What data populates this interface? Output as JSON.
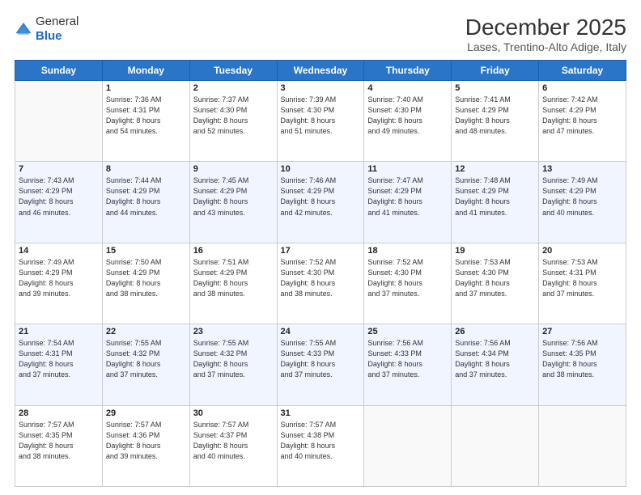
{
  "logo": {
    "general": "General",
    "blue": "Blue"
  },
  "header": {
    "title": "December 2025",
    "subtitle": "Lases, Trentino-Alto Adige, Italy"
  },
  "days_of_week": [
    "Sunday",
    "Monday",
    "Tuesday",
    "Wednesday",
    "Thursday",
    "Friday",
    "Saturday"
  ],
  "weeks": [
    [
      {
        "day": "",
        "info": ""
      },
      {
        "day": "1",
        "info": "Sunrise: 7:36 AM\nSunset: 4:31 PM\nDaylight: 8 hours\nand 54 minutes."
      },
      {
        "day": "2",
        "info": "Sunrise: 7:37 AM\nSunset: 4:30 PM\nDaylight: 8 hours\nand 52 minutes."
      },
      {
        "day": "3",
        "info": "Sunrise: 7:39 AM\nSunset: 4:30 PM\nDaylight: 8 hours\nand 51 minutes."
      },
      {
        "day": "4",
        "info": "Sunrise: 7:40 AM\nSunset: 4:30 PM\nDaylight: 8 hours\nand 49 minutes."
      },
      {
        "day": "5",
        "info": "Sunrise: 7:41 AM\nSunset: 4:29 PM\nDaylight: 8 hours\nand 48 minutes."
      },
      {
        "day": "6",
        "info": "Sunrise: 7:42 AM\nSunset: 4:29 PM\nDaylight: 8 hours\nand 47 minutes."
      }
    ],
    [
      {
        "day": "7",
        "info": "Sunrise: 7:43 AM\nSunset: 4:29 PM\nDaylight: 8 hours\nand 46 minutes."
      },
      {
        "day": "8",
        "info": "Sunrise: 7:44 AM\nSunset: 4:29 PM\nDaylight: 8 hours\nand 44 minutes."
      },
      {
        "day": "9",
        "info": "Sunrise: 7:45 AM\nSunset: 4:29 PM\nDaylight: 8 hours\nand 43 minutes."
      },
      {
        "day": "10",
        "info": "Sunrise: 7:46 AM\nSunset: 4:29 PM\nDaylight: 8 hours\nand 42 minutes."
      },
      {
        "day": "11",
        "info": "Sunrise: 7:47 AM\nSunset: 4:29 PM\nDaylight: 8 hours\nand 41 minutes."
      },
      {
        "day": "12",
        "info": "Sunrise: 7:48 AM\nSunset: 4:29 PM\nDaylight: 8 hours\nand 41 minutes."
      },
      {
        "day": "13",
        "info": "Sunrise: 7:49 AM\nSunset: 4:29 PM\nDaylight: 8 hours\nand 40 minutes."
      }
    ],
    [
      {
        "day": "14",
        "info": "Sunrise: 7:49 AM\nSunset: 4:29 PM\nDaylight: 8 hours\nand 39 minutes."
      },
      {
        "day": "15",
        "info": "Sunrise: 7:50 AM\nSunset: 4:29 PM\nDaylight: 8 hours\nand 38 minutes."
      },
      {
        "day": "16",
        "info": "Sunrise: 7:51 AM\nSunset: 4:29 PM\nDaylight: 8 hours\nand 38 minutes."
      },
      {
        "day": "17",
        "info": "Sunrise: 7:52 AM\nSunset: 4:30 PM\nDaylight: 8 hours\nand 38 minutes."
      },
      {
        "day": "18",
        "info": "Sunrise: 7:52 AM\nSunset: 4:30 PM\nDaylight: 8 hours\nand 37 minutes."
      },
      {
        "day": "19",
        "info": "Sunrise: 7:53 AM\nSunset: 4:30 PM\nDaylight: 8 hours\nand 37 minutes."
      },
      {
        "day": "20",
        "info": "Sunrise: 7:53 AM\nSunset: 4:31 PM\nDaylight: 8 hours\nand 37 minutes."
      }
    ],
    [
      {
        "day": "21",
        "info": "Sunrise: 7:54 AM\nSunset: 4:31 PM\nDaylight: 8 hours\nand 37 minutes."
      },
      {
        "day": "22",
        "info": "Sunrise: 7:55 AM\nSunset: 4:32 PM\nDaylight: 8 hours\nand 37 minutes."
      },
      {
        "day": "23",
        "info": "Sunrise: 7:55 AM\nSunset: 4:32 PM\nDaylight: 8 hours\nand 37 minutes."
      },
      {
        "day": "24",
        "info": "Sunrise: 7:55 AM\nSunset: 4:33 PM\nDaylight: 8 hours\nand 37 minutes."
      },
      {
        "day": "25",
        "info": "Sunrise: 7:56 AM\nSunset: 4:33 PM\nDaylight: 8 hours\nand 37 minutes."
      },
      {
        "day": "26",
        "info": "Sunrise: 7:56 AM\nSunset: 4:34 PM\nDaylight: 8 hours\nand 37 minutes."
      },
      {
        "day": "27",
        "info": "Sunrise: 7:56 AM\nSunset: 4:35 PM\nDaylight: 8 hours\nand 38 minutes."
      }
    ],
    [
      {
        "day": "28",
        "info": "Sunrise: 7:57 AM\nSunset: 4:35 PM\nDaylight: 8 hours\nand 38 minutes."
      },
      {
        "day": "29",
        "info": "Sunrise: 7:57 AM\nSunset: 4:36 PM\nDaylight: 8 hours\nand 39 minutes."
      },
      {
        "day": "30",
        "info": "Sunrise: 7:57 AM\nSunset: 4:37 PM\nDaylight: 8 hours\nand 40 minutes."
      },
      {
        "day": "31",
        "info": "Sunrise: 7:57 AM\nSunset: 4:38 PM\nDaylight: 8 hours\nand 40 minutes."
      },
      {
        "day": "",
        "info": ""
      },
      {
        "day": "",
        "info": ""
      },
      {
        "day": "",
        "info": ""
      }
    ]
  ]
}
